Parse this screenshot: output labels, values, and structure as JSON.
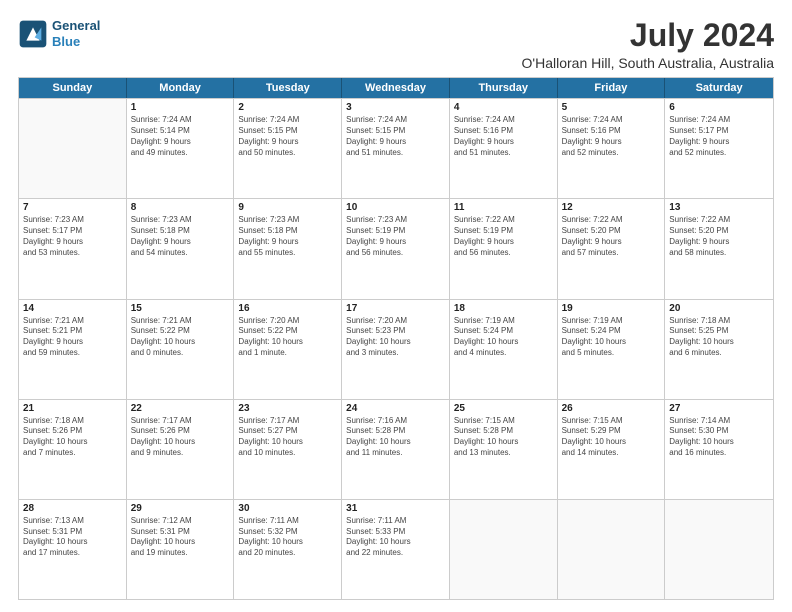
{
  "header": {
    "logo_line1": "General",
    "logo_line2": "Blue",
    "title": "July 2024",
    "subtitle": "O'Halloran Hill, South Australia, Australia"
  },
  "calendar": {
    "days_of_week": [
      "Sunday",
      "Monday",
      "Tuesday",
      "Wednesday",
      "Thursday",
      "Friday",
      "Saturday"
    ],
    "rows": [
      [
        {
          "day": null,
          "lines": []
        },
        {
          "day": "1",
          "lines": [
            "Sunrise: 7:24 AM",
            "Sunset: 5:14 PM",
            "Daylight: 9 hours",
            "and 49 minutes."
          ]
        },
        {
          "day": "2",
          "lines": [
            "Sunrise: 7:24 AM",
            "Sunset: 5:15 PM",
            "Daylight: 9 hours",
            "and 50 minutes."
          ]
        },
        {
          "day": "3",
          "lines": [
            "Sunrise: 7:24 AM",
            "Sunset: 5:15 PM",
            "Daylight: 9 hours",
            "and 51 minutes."
          ]
        },
        {
          "day": "4",
          "lines": [
            "Sunrise: 7:24 AM",
            "Sunset: 5:16 PM",
            "Daylight: 9 hours",
            "and 51 minutes."
          ]
        },
        {
          "day": "5",
          "lines": [
            "Sunrise: 7:24 AM",
            "Sunset: 5:16 PM",
            "Daylight: 9 hours",
            "and 52 minutes."
          ]
        },
        {
          "day": "6",
          "lines": [
            "Sunrise: 7:24 AM",
            "Sunset: 5:17 PM",
            "Daylight: 9 hours",
            "and 52 minutes."
          ]
        }
      ],
      [
        {
          "day": "7",
          "lines": [
            "Sunrise: 7:23 AM",
            "Sunset: 5:17 PM",
            "Daylight: 9 hours",
            "and 53 minutes."
          ]
        },
        {
          "day": "8",
          "lines": [
            "Sunrise: 7:23 AM",
            "Sunset: 5:18 PM",
            "Daylight: 9 hours",
            "and 54 minutes."
          ]
        },
        {
          "day": "9",
          "lines": [
            "Sunrise: 7:23 AM",
            "Sunset: 5:18 PM",
            "Daylight: 9 hours",
            "and 55 minutes."
          ]
        },
        {
          "day": "10",
          "lines": [
            "Sunrise: 7:23 AM",
            "Sunset: 5:19 PM",
            "Daylight: 9 hours",
            "and 56 minutes."
          ]
        },
        {
          "day": "11",
          "lines": [
            "Sunrise: 7:22 AM",
            "Sunset: 5:19 PM",
            "Daylight: 9 hours",
            "and 56 minutes."
          ]
        },
        {
          "day": "12",
          "lines": [
            "Sunrise: 7:22 AM",
            "Sunset: 5:20 PM",
            "Daylight: 9 hours",
            "and 57 minutes."
          ]
        },
        {
          "day": "13",
          "lines": [
            "Sunrise: 7:22 AM",
            "Sunset: 5:20 PM",
            "Daylight: 9 hours",
            "and 58 minutes."
          ]
        }
      ],
      [
        {
          "day": "14",
          "lines": [
            "Sunrise: 7:21 AM",
            "Sunset: 5:21 PM",
            "Daylight: 9 hours",
            "and 59 minutes."
          ]
        },
        {
          "day": "15",
          "lines": [
            "Sunrise: 7:21 AM",
            "Sunset: 5:22 PM",
            "Daylight: 10 hours",
            "and 0 minutes."
          ]
        },
        {
          "day": "16",
          "lines": [
            "Sunrise: 7:20 AM",
            "Sunset: 5:22 PM",
            "Daylight: 10 hours",
            "and 1 minute."
          ]
        },
        {
          "day": "17",
          "lines": [
            "Sunrise: 7:20 AM",
            "Sunset: 5:23 PM",
            "Daylight: 10 hours",
            "and 3 minutes."
          ]
        },
        {
          "day": "18",
          "lines": [
            "Sunrise: 7:19 AM",
            "Sunset: 5:24 PM",
            "Daylight: 10 hours",
            "and 4 minutes."
          ]
        },
        {
          "day": "19",
          "lines": [
            "Sunrise: 7:19 AM",
            "Sunset: 5:24 PM",
            "Daylight: 10 hours",
            "and 5 minutes."
          ]
        },
        {
          "day": "20",
          "lines": [
            "Sunrise: 7:18 AM",
            "Sunset: 5:25 PM",
            "Daylight: 10 hours",
            "and 6 minutes."
          ]
        }
      ],
      [
        {
          "day": "21",
          "lines": [
            "Sunrise: 7:18 AM",
            "Sunset: 5:26 PM",
            "Daylight: 10 hours",
            "and 7 minutes."
          ]
        },
        {
          "day": "22",
          "lines": [
            "Sunrise: 7:17 AM",
            "Sunset: 5:26 PM",
            "Daylight: 10 hours",
            "and 9 minutes."
          ]
        },
        {
          "day": "23",
          "lines": [
            "Sunrise: 7:17 AM",
            "Sunset: 5:27 PM",
            "Daylight: 10 hours",
            "and 10 minutes."
          ]
        },
        {
          "day": "24",
          "lines": [
            "Sunrise: 7:16 AM",
            "Sunset: 5:28 PM",
            "Daylight: 10 hours",
            "and 11 minutes."
          ]
        },
        {
          "day": "25",
          "lines": [
            "Sunrise: 7:15 AM",
            "Sunset: 5:28 PM",
            "Daylight: 10 hours",
            "and 13 minutes."
          ]
        },
        {
          "day": "26",
          "lines": [
            "Sunrise: 7:15 AM",
            "Sunset: 5:29 PM",
            "Daylight: 10 hours",
            "and 14 minutes."
          ]
        },
        {
          "day": "27",
          "lines": [
            "Sunrise: 7:14 AM",
            "Sunset: 5:30 PM",
            "Daylight: 10 hours",
            "and 16 minutes."
          ]
        }
      ],
      [
        {
          "day": "28",
          "lines": [
            "Sunrise: 7:13 AM",
            "Sunset: 5:31 PM",
            "Daylight: 10 hours",
            "and 17 minutes."
          ]
        },
        {
          "day": "29",
          "lines": [
            "Sunrise: 7:12 AM",
            "Sunset: 5:31 PM",
            "Daylight: 10 hours",
            "and 19 minutes."
          ]
        },
        {
          "day": "30",
          "lines": [
            "Sunrise: 7:11 AM",
            "Sunset: 5:32 PM",
            "Daylight: 10 hours",
            "and 20 minutes."
          ]
        },
        {
          "day": "31",
          "lines": [
            "Sunrise: 7:11 AM",
            "Sunset: 5:33 PM",
            "Daylight: 10 hours",
            "and 22 minutes."
          ]
        },
        {
          "day": null,
          "lines": []
        },
        {
          "day": null,
          "lines": []
        },
        {
          "day": null,
          "lines": []
        }
      ]
    ]
  }
}
